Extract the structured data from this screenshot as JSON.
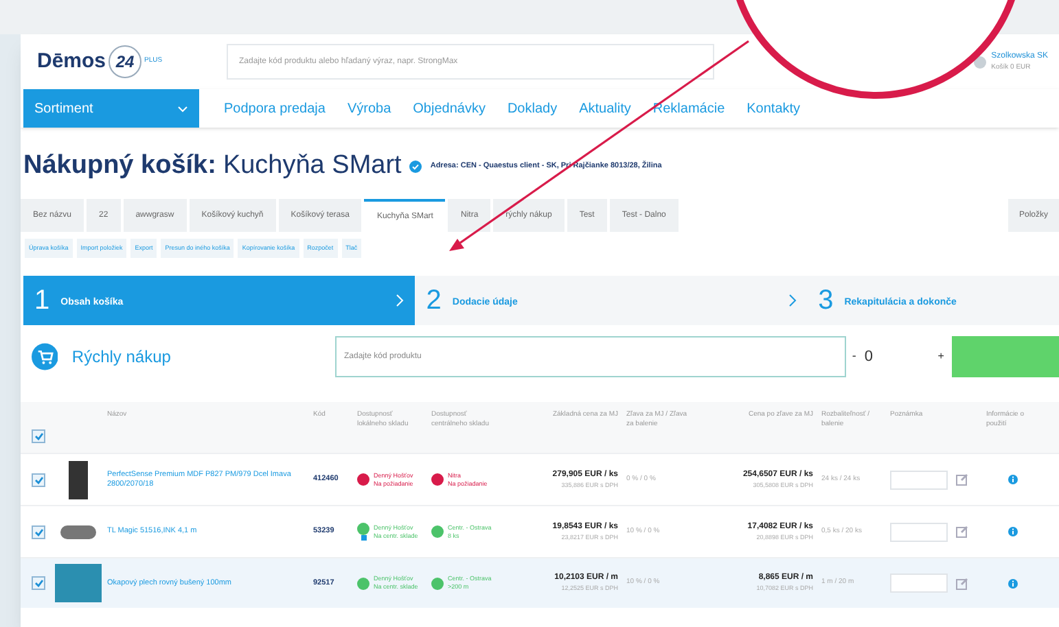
{
  "header": {
    "logo_text": "Dēmos",
    "logo_badge": "24",
    "logo_badge_sup": "PLUS",
    "search_placeholder": "Zadajte kód produktu alebo hľadaný výraz, napr. StrongMax",
    "user_name": "Szolkowska SK",
    "user_sub": "Košík 0 EUR"
  },
  "nav": {
    "menu_button": "Sortiment",
    "items": [
      "Podpora predaja",
      "Výroba",
      "Objednávky",
      "Doklady",
      "Aktuality",
      "Reklamácie",
      "Kontakty"
    ]
  },
  "title": {
    "label": "Nákupný košík:",
    "name": "Kuchyňa SMart",
    "address": "Adresa: CEN - Quaestus client - SK, Pri Rajčianke 8013/28, Žilina"
  },
  "tabs": [
    {
      "label": "Bez názvu",
      "selected": false
    },
    {
      "label": "22",
      "selected": false
    },
    {
      "label": "awwgrasw",
      "selected": false
    },
    {
      "label": "Košíkový kuchyň",
      "selected": false
    },
    {
      "label": "Košíkový terasa",
      "selected": false
    },
    {
      "label": "Kuchyňa SMart",
      "selected": true
    },
    {
      "label": "Nitra",
      "selected": false
    },
    {
      "label": "rýchly nákup",
      "selected": false
    },
    {
      "label": "Test",
      "selected": false
    },
    {
      "label": "Test - Dalno",
      "selected": false
    }
  ],
  "tabs_right": "Položky",
  "actions": [
    "Úprava košíka",
    "Import položiek",
    "Export",
    "Presun do iného košíka",
    "Kopírovanie košíka",
    "Rozpočet",
    "Tlač"
  ],
  "steps": [
    {
      "number": "1",
      "label": "Obsah košíka",
      "selected": true
    },
    {
      "number": "2",
      "label": "Dodacie údaje",
      "selected": false
    },
    {
      "number": "3",
      "label": "Rekapitulácia a dokonče",
      "selected": false
    }
  ],
  "quick_buy": {
    "title": "Rýchly nákup",
    "placeholder": "Zadajte kód produktu",
    "minus": "-",
    "quantity": "0",
    "plus": "+"
  },
  "table": {
    "all_checked": true,
    "columns": [
      "Názov",
      "Kód",
      "Dostupnosť lokálneho skladu",
      "Dostupnosť centrálneho skladu",
      "Základná cena za MJ",
      "Zľava za MJ / Zľava za balenie",
      "Cena po zľave za MJ",
      "Rozbaliteľnosť / balenie",
      "Poznámka",
      "Informácie o použití"
    ],
    "rows": [
      {
        "checked": true,
        "highlighted": false,
        "name": "PerfectSense Premium MDF P827 PM/979 Dcel Imava 2800/2070/18",
        "code": "412460",
        "local": {
          "color": "#d81b4a",
          "line1": "Denný Hošťov",
          "line2": "Na požiadanie",
          "info": false
        },
        "central": {
          "color": "#d81b4a",
          "line1": "Nitra",
          "line2": "Na požiadanie"
        },
        "price": "279,905 EUR / ks",
        "price_vat": "335,886 EUR s DPH",
        "discount": "0 % / 0 %",
        "final": "254,6507 EUR / ks",
        "final_vat": "305,5808 EUR s DPH",
        "pack": "24 ks / 24 ks"
      },
      {
        "checked": true,
        "highlighted": false,
        "name": "TL Magic 51516,INK 4,1 m",
        "code": "53239",
        "local": {
          "color": "#4cc36a",
          "line1": "Denný Hošťov",
          "line2": "Na centr. sklade",
          "info": true
        },
        "central": {
          "color": "#4cc36a",
          "line1": "Centr. - Ostrava",
          "line2": "8 ks"
        },
        "price": "19,8543 EUR / ks",
        "price_vat": "23,8217 EUR s DPH",
        "discount": "10 % / 0 %",
        "final": "17,4082 EUR / ks",
        "final_vat": "20,8898 EUR s DPH",
        "pack": "0,5 ks / 20 ks"
      },
      {
        "checked": true,
        "highlighted": true,
        "name": "Okapový plech rovný bušený 100mm",
        "code": "92517",
        "local": {
          "color": "#4cc36a",
          "line1": "Denný Hošťov",
          "line2": "Na centr. sklade",
          "info": false
        },
        "central": {
          "color": "#4cc36a",
          "line1": "Centr. - Ostrava",
          "line2": ">200 m"
        },
        "price": "10,2103 EUR / m",
        "price_vat": "12,2525 EUR s DPH",
        "discount": "10 % / 0 %",
        "final": "8,865 EUR / m",
        "final_vat": "10,7082 EUR s DPH",
        "pack": "1 m / 20 m"
      }
    ]
  }
}
